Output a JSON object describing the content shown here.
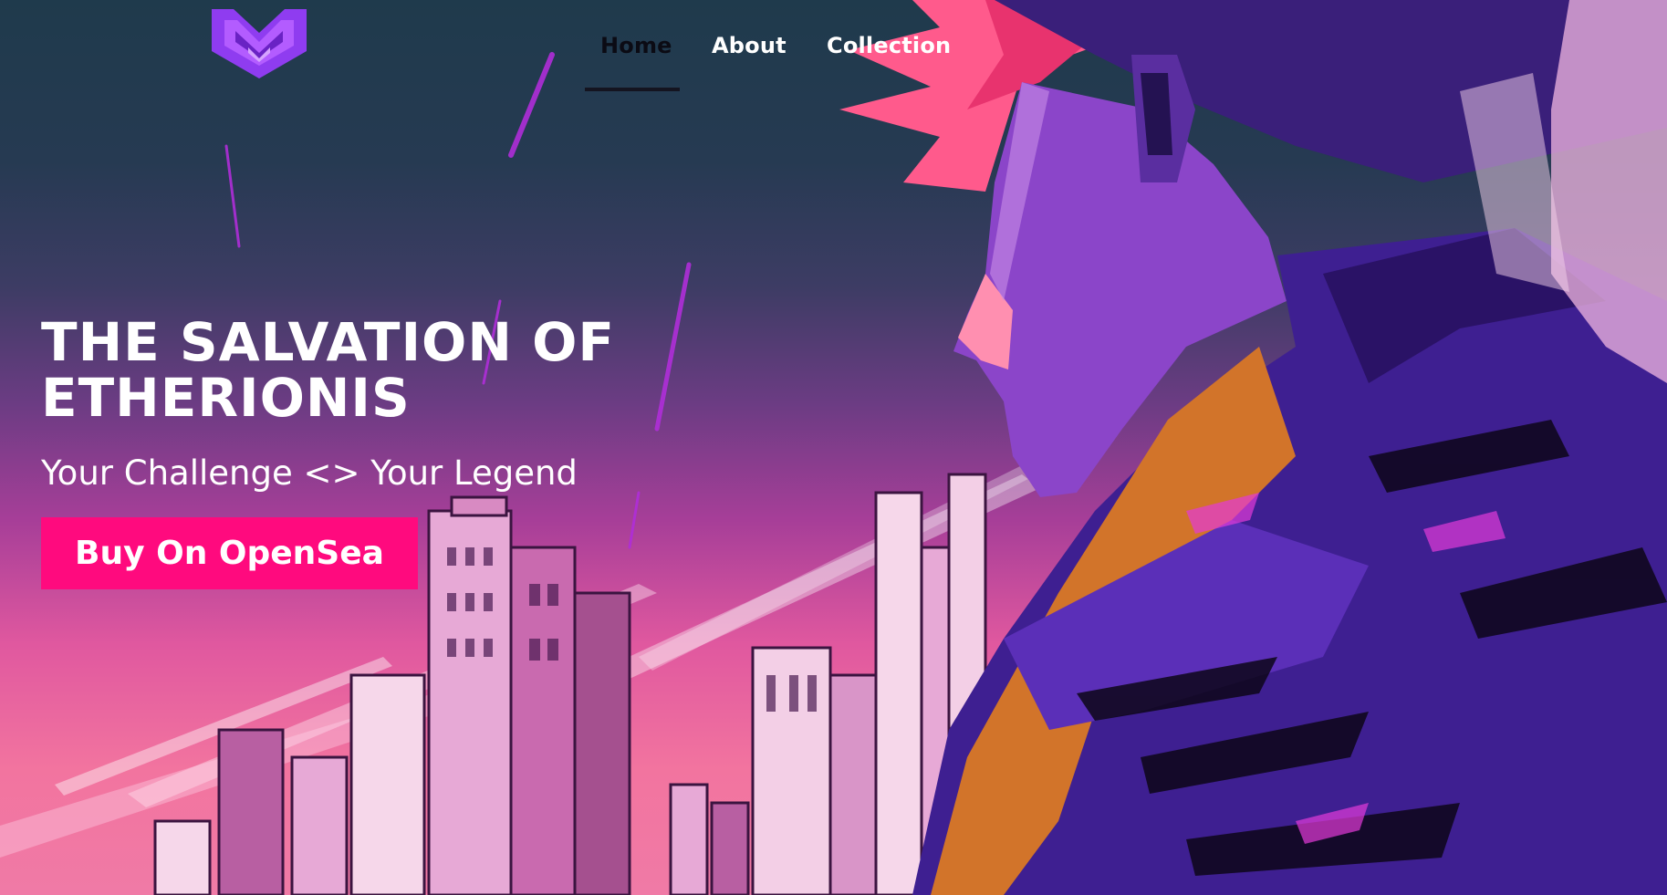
{
  "brand": {
    "logo_icon": "shield-v-logo-icon",
    "logo_color": "#9b3dff"
  },
  "nav": {
    "items": [
      {
        "label": "Home",
        "active": true
      },
      {
        "label": "About",
        "active": false
      },
      {
        "label": "Collection",
        "active": false
      }
    ]
  },
  "hero": {
    "title": "THE SALVATION OF ETHERIONIS",
    "subtitle": "Your Challenge <> Your Legend",
    "cta_label": "Buy On OpenSea",
    "cta_color": "#ff0a7e",
    "background_art": "cyberpunk-hero-illustration"
  }
}
